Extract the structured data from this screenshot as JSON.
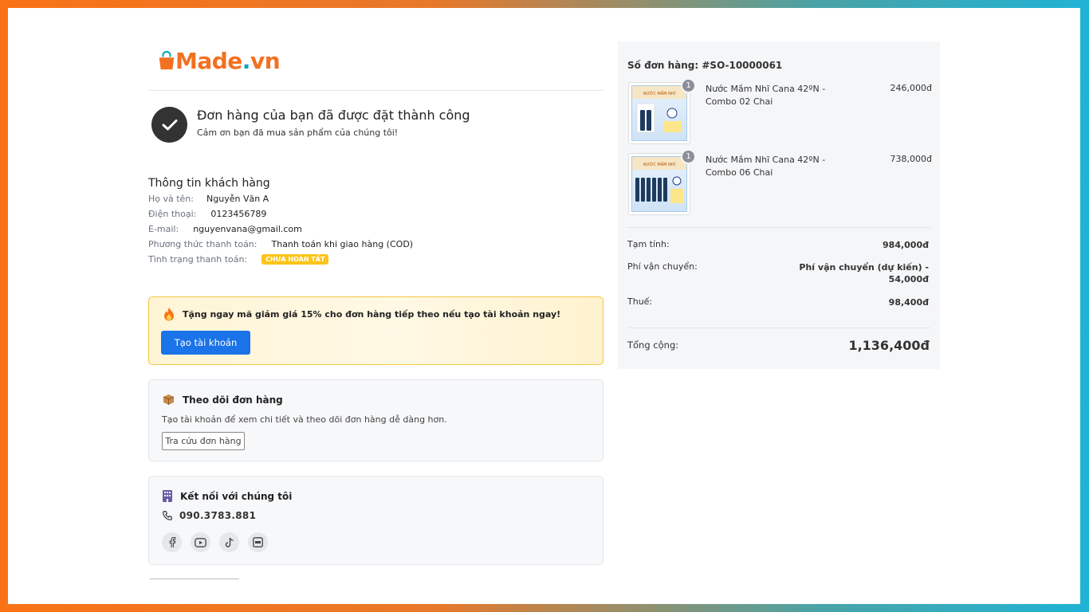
{
  "brand": {
    "name_main": "Made",
    "name_dot": ".",
    "name_tld": "vn",
    "primary_color": "#f37021",
    "accent_color": "#0ea5b7"
  },
  "success": {
    "title": "Đơn hàng của bạn đã được đặt thành công",
    "subtitle": "Cảm ơn bạn đã mua sản phẩm của chúng tôi!"
  },
  "customer": {
    "heading": "Thông tin khách hàng",
    "name_label": "Họ và tên:",
    "name_value": "Nguyễn Văn A",
    "phone_label": "Điện thoại:",
    "phone_value": "0123456789",
    "email_label": "E-mail:",
    "email_value": "nguyenvana@gmail.com",
    "payment_method_label": "Phương thức thanh toán:",
    "payment_method_value": "Thanh toán khi giao hàng (COD)",
    "payment_status_label": "Tình trạng thanh toán:",
    "payment_status_badge": "CHƯA HOÀN TẤT"
  },
  "promo": {
    "icon": "fire-icon",
    "text": "Tặng ngay mã giảm giá 15% cho đơn hàng tiếp theo nếu tạo tài khoản ngay!",
    "button_label": "Tạo tài khoản"
  },
  "tracking": {
    "icon": "package-icon",
    "title": "Theo dõi đơn hàng",
    "description": "Tạo tài khoản để xem chi tiết và theo dõi đơn hàng dễ dàng hơn.",
    "button_label": "Tra cứu đơn hàng"
  },
  "connect": {
    "icon": "building-icon",
    "title": "Kết nối với chúng tôi",
    "phone": "090.3783.881",
    "socials": [
      "facebook-icon",
      "youtube-icon",
      "tiktok-icon",
      "zalo-icon"
    ]
  },
  "order": {
    "number_label": "Số đơn hàng: #SO-10000061",
    "items": [
      {
        "name": "Nước Mắm Nhĩ Cana 42ºN - Combo 02 Chai",
        "price": "246,000đ",
        "qty": "1"
      },
      {
        "name": "Nước Mắm Nhĩ Cana 42ºN - Combo 06 Chai",
        "price": "738,000đ",
        "qty": "1"
      }
    ],
    "subtotal_label": "Tạm tính:",
    "subtotal_value": "984,000đ",
    "shipping_label": "Phí vận chuyển:",
    "shipping_value_line1": "Phí vận chuyển (dự kiến) -",
    "shipping_value_line2": "54,000đ",
    "tax_label": "Thuế:",
    "tax_value": "98,400đ",
    "total_label": "Tổng cộng:",
    "total_value": "1,136,400đ"
  }
}
